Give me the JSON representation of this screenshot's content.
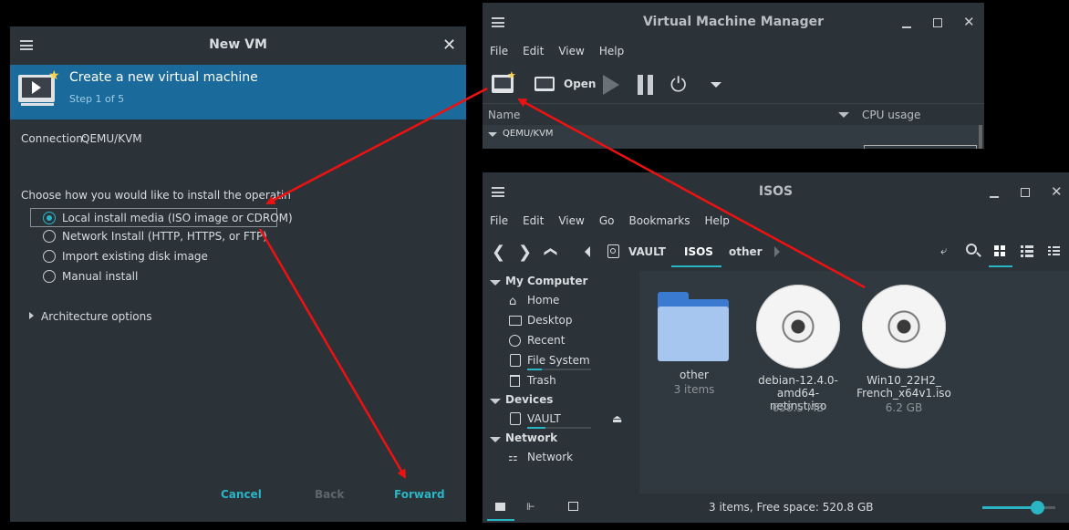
{
  "newvm": {
    "title": "New VM",
    "header_title": "Create a new virtual machine",
    "header_step": "Step 1 of 5",
    "connection_label": "Connection:",
    "connection_value": "QEMU/KVM",
    "choose_label": "Choose how you would like to install the operating system",
    "options": [
      "Local install media (ISO image or CDROM)",
      "Network Install (HTTP, HTTPS, or FTP)",
      "Import existing disk image",
      "Manual install"
    ],
    "selected_option": 0,
    "arch_label": "Architecture options",
    "cancel": "Cancel",
    "back": "Back",
    "forward": "Forward"
  },
  "vmm": {
    "title": "Virtual Machine Manager",
    "menu": [
      "File",
      "Edit",
      "View",
      "Help"
    ],
    "open_label": "Open",
    "col_name": "Name",
    "col_cpu": "CPU usage",
    "group": "QEMU/KVM"
  },
  "isos": {
    "title": "ISOS",
    "menu": [
      "File",
      "Edit",
      "View",
      "Go",
      "Bookmarks",
      "Help"
    ],
    "crumbs": [
      "VAULT",
      "ISOS",
      "other"
    ],
    "sidebar": {
      "my_computer": "My Computer",
      "items": [
        "Home",
        "Desktop",
        "Recent",
        "File System",
        "Trash"
      ],
      "devices": "Devices",
      "device_items": [
        "VAULT"
      ],
      "network": "Network",
      "network_items": [
        "Network"
      ]
    },
    "files": [
      {
        "name": "other",
        "sub": "3 items",
        "icon": "folder-icon"
      },
      {
        "name": "debian-12.4.0-\namd64-netinst.iso",
        "sub": "658.5 MB",
        "icon": "disc-icon"
      },
      {
        "name": "Win10_22H2_\nFrench_x64v1.iso",
        "sub": "6.2 GB",
        "icon": "disc-icon"
      }
    ],
    "status": "3 items, Free space: 520.8 GB",
    "zoom_level": 0.75
  },
  "colors": {
    "accent": "#2ab5c5",
    "header_blue": "#1a6b9c",
    "arrow": "#ee1111",
    "folder": "#5a8fd8"
  }
}
